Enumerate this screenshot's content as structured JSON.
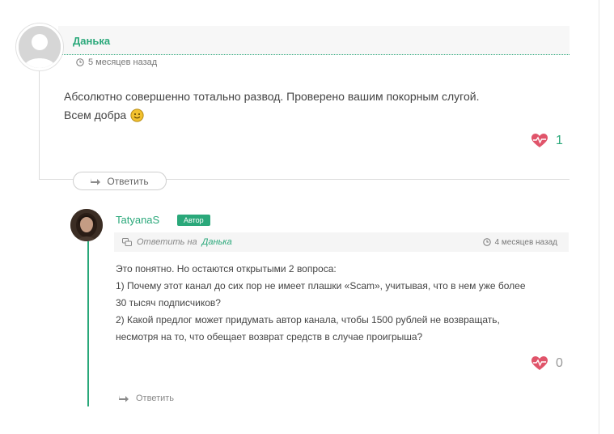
{
  "comment1": {
    "author": "Данька",
    "time": "5 месяцев назад",
    "text_line1": "Абсолютно совершенно тотально развод. Проверено вашим покорным слугой.",
    "text_line2": "Всем добра",
    "emoji": "smiling-face",
    "likes": "1",
    "reply_label": "Ответить"
  },
  "comment2": {
    "author": "TatyanaS",
    "badge": "Автор",
    "reply_to_prefix": "Ответить на",
    "reply_to_name": "Данька",
    "time": "4 месяцев назад",
    "lines": [
      "Это понятно. Но остаются открытыми 2 вопроса:",
      "1) Почему этот канал до сих пор не имеет плашки «Scam», учитывая, что в нем уже более",
      "30 тысяч подписчиков?",
      "2) Какой предлог может придумать автор канала, чтобы 1500 рублей не возвращать,",
      "несмотря на то, что обещает возврат средств в случае проигрыша?"
    ],
    "likes": "0",
    "reply_label": "Ответить"
  },
  "colors": {
    "accent": "#2aa87a",
    "heart": "#e0546a",
    "emoji": "#f2c12e"
  }
}
